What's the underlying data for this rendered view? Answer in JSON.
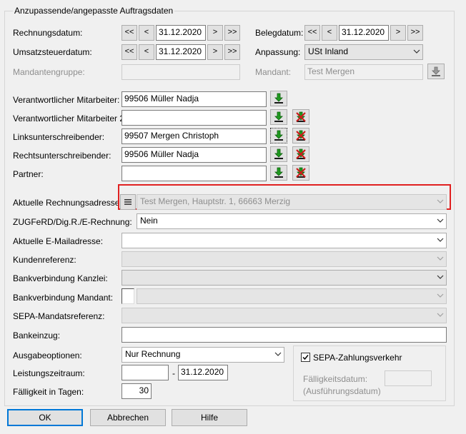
{
  "group_title": "Anzupassende/angepasste Auftragsdaten",
  "rechnungsdatum": {
    "label": "Rechnungsdatum:",
    "value": "31.12.2020"
  },
  "belegdatum": {
    "label": "Belegdatum:",
    "value": "31.12.2020"
  },
  "umsatzsteuerdatum": {
    "label": "Umsatzsteuerdatum:",
    "value": "31.12.2020"
  },
  "anpassung": {
    "label": "Anpassung:",
    "value": "USt Inland"
  },
  "mandantengruppe": {
    "label": "Mandantengruppe:",
    "value": ""
  },
  "mandant": {
    "label": "Mandant:",
    "value": "Test Mergen"
  },
  "nav": {
    "first": "<<",
    "prev": "<",
    "next": ">",
    "last": ">>"
  },
  "persons": {
    "verantwortlicher": {
      "label": "Verantwortlicher Mitarbeiter:",
      "value": "99506 Müller Nadja"
    },
    "verantwortlicher2": {
      "label": "Verantwortlicher Mitarbeiter 2:",
      "value": ""
    },
    "links": {
      "label": "Linksunterschreibender:",
      "value": "99507 Mergen Christoph"
    },
    "rechts": {
      "label": "Rechtsunterschreibender:",
      "value": "99506 Müller Nadja"
    },
    "partner": {
      "label": "Partner:",
      "value": ""
    }
  },
  "rechnungsadresse": {
    "label": "Aktuelle Rechnungsadresse:",
    "value": "Test Mergen, Hauptstr. 1, 66663 Merzig"
  },
  "zugferd": {
    "label": "ZUGFeRD/Dig.R./E-Rechnung:",
    "value": "Nein"
  },
  "emailadresse": {
    "label": "Aktuelle E-Mailadresse:",
    "value": ""
  },
  "kundenreferenz": {
    "label": "Kundenreferenz:",
    "value": ""
  },
  "bank_kanzlei": {
    "label": "Bankverbindung Kanzlei:",
    "value": ""
  },
  "bank_mandant": {
    "label": "Bankverbindung Mandant:",
    "value": ""
  },
  "sepa_ref": {
    "label": "SEPA-Mandatsreferenz:",
    "value": ""
  },
  "bankeinzug": {
    "label": "Bankeinzug:",
    "value": ""
  },
  "ausgabeoptionen": {
    "label": "Ausgabeoptionen:",
    "value": "Nur Rechnung"
  },
  "leistungszeitraum": {
    "label": "Leistungszeitraum:",
    "from": "",
    "sep": "-",
    "to": "31.12.2020"
  },
  "faelligkeit": {
    "label": "Fälligkeit in Tagen:",
    "value": "30"
  },
  "sepa": {
    "checkbox_label": "SEPA-Zahlungsverkehr",
    "checked": true,
    "faelligkeitsdatum_label": "Fälligkeitsdatum:",
    "ausfuehrung_label": "(Ausführungsdatum)",
    "faelligkeitsdatum_value": ""
  },
  "buttons": {
    "ok": "OK",
    "abbrechen": "Abbrechen",
    "hilfe": "Hilfe"
  },
  "colors": {
    "highlight_border": "#e02020",
    "download_arrow": "#1f9a1f",
    "delete_x": "#cc1a1a"
  }
}
